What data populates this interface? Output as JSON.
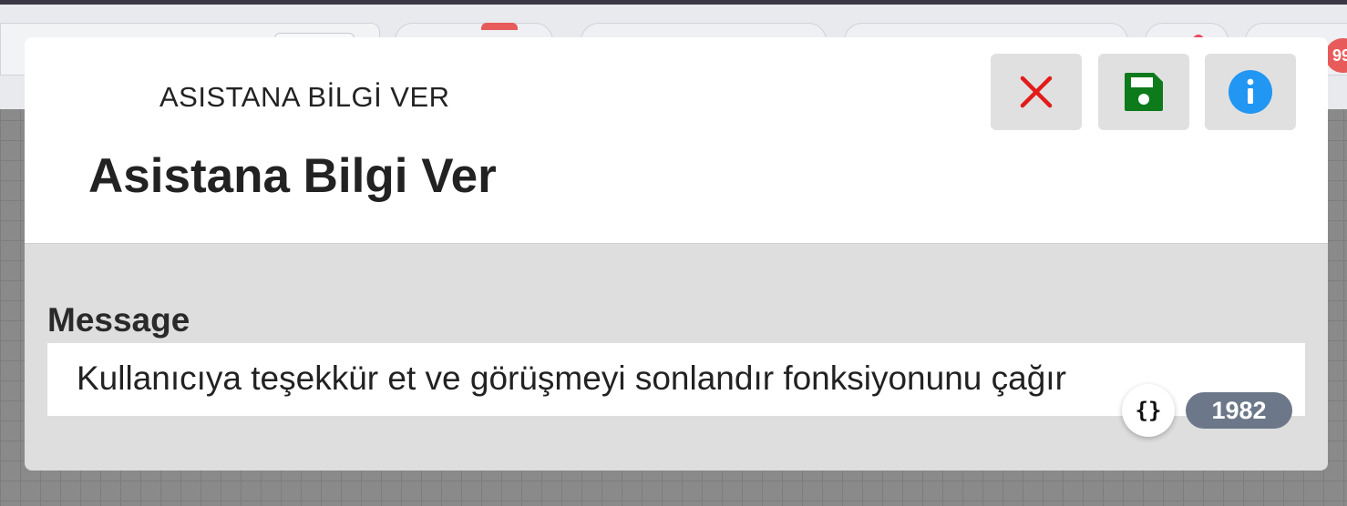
{
  "background": {
    "notification_count": "99"
  },
  "dialog": {
    "subtitle": "ASISTANA BİLGİ VER",
    "title": "Asistana Bilgi Ver",
    "buttons": {
      "close_icon": "close-icon",
      "save_icon": "save-icon",
      "info_icon": "info-icon"
    },
    "message": {
      "label": "Message",
      "value": "Kullanıcıya teşekkür et ve görüşmeyi sonlandır fonksiyonunu çağır",
      "variables_button": "{}",
      "char_count": "1982"
    }
  },
  "colors": {
    "close": "#e21b1b",
    "save": "#0d7a1c",
    "info": "#2196f3",
    "badge": "#6c7789"
  }
}
